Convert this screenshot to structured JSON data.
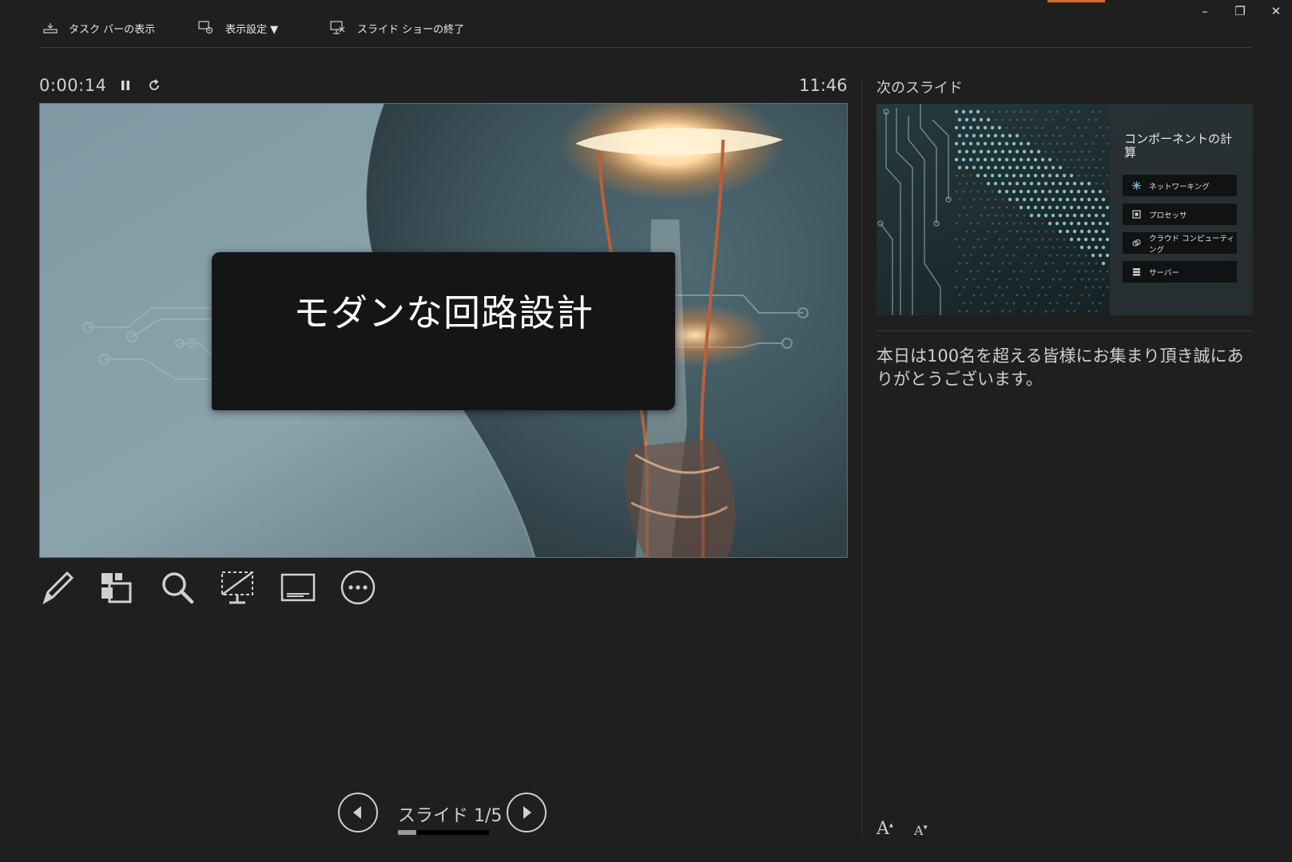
{
  "toolbar": {
    "show_taskbar": "タスク バーの表示",
    "display_settings": "表示設定 ▼",
    "end_slideshow": "スライド ショーの終了"
  },
  "window_controls": {
    "minimize": "–",
    "restore": "❐",
    "close": "✕"
  },
  "timer": {
    "elapsed": "0:00:14",
    "pause_icon": "pause-icon",
    "reset_icon": "reset-icon"
  },
  "clock": "11:46",
  "current_slide": {
    "title": "モダンな回路設計"
  },
  "tools": [
    "pen-icon",
    "see-all-slides-icon",
    "zoom-icon",
    "black-screen-icon",
    "subtitles-icon",
    "more-options-icon"
  ],
  "navigation": {
    "counter": "スライド 1/5",
    "current": 1,
    "total": 5,
    "progress_fraction": 0.2
  },
  "next_slide": {
    "label": "次のスライド",
    "title": "コンポーネントの計算",
    "items": [
      {
        "label": "ネットワーキング",
        "icon": "network-icon"
      },
      {
        "label": "プロセッサ",
        "icon": "processor-icon"
      },
      {
        "label": "クラウド コンピューティング",
        "icon": "cloud-icon"
      },
      {
        "label": "サーバー",
        "icon": "server-icon"
      }
    ]
  },
  "notes": "本日は100名を超える皆様にお集まり頂き誠にありがとうございます。",
  "font_size": {
    "increase": "A",
    "decrease": "A"
  },
  "colors": {
    "background": "#1f1f1f",
    "accent": "#d86a2c",
    "text": "#d8d8d8"
  }
}
